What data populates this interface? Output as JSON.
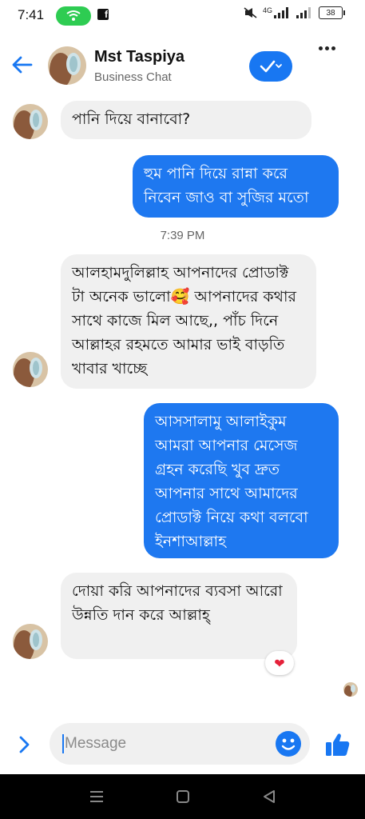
{
  "status": {
    "time": "7:41",
    "battery": "38",
    "network": "4G"
  },
  "header": {
    "name": "Mst Taspiya",
    "subtitle": "Business Chat"
  },
  "messages": [
    {
      "direction": "in",
      "text": "পানি দিয়ে বানাবো?"
    },
    {
      "direction": "out",
      "text": "হুম পানি দিয়ে রান্না করে নিবেন জাও বা সুজির মতো"
    },
    {
      "direction": "in",
      "text": "আলহামদুলিল্লাহ আপনাদের প্রোডাক্ট টা অনেক ভালো🥰 আপনাদের কথার সাথে কাজে মিল আছে,, পাঁচ দিনে আল্লাহর রহমতে আমার ভাই বাড়তি খাবার খাচ্ছে"
    },
    {
      "direction": "out",
      "text": "আসসালামু আলাইকুম আমরা আপনার মেসেজ গ্রহন করেছি খুব দ্রুত আপনার সাথে আমাদের প্রোডাক্ট নিয়ে কথা বলবো ইনশাআল্লাহ"
    },
    {
      "direction": "in",
      "text": "দোয়া করি আপনাদের ব্যবসা আরো উন্নতি দান করে আল্লাহ্",
      "reaction": "❤"
    }
  ],
  "timestamp": "7:39 PM",
  "composer": {
    "placeholder": "Message"
  },
  "colors": {
    "accent": "#1877f2",
    "outgoing_bubble": "#1e78f0",
    "incoming_bubble": "#f0f0f0",
    "hotspot": "#2ecc52"
  }
}
